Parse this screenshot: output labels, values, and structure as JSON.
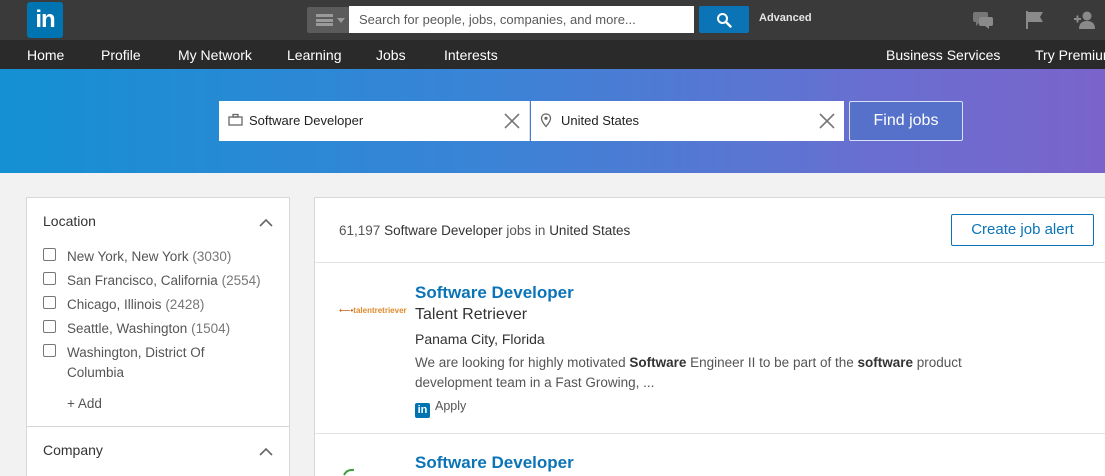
{
  "topbar": {
    "logo": "in",
    "search": {
      "placeholder": "Search for people, jobs, companies, and more..."
    },
    "advanced_label": "Advanced",
    "icons": [
      "messages-icon",
      "flag-icon",
      "add-connection-icon"
    ]
  },
  "nav": {
    "items": [
      "Home",
      "Profile",
      "My Network",
      "Learning",
      "Jobs",
      "Interests"
    ],
    "right_items": [
      "Business Services",
      "Try Premium"
    ]
  },
  "job_search": {
    "keyword": "Software Developer",
    "location": "United States",
    "button_label": "Find jobs"
  },
  "filters": {
    "location": {
      "title": "Location",
      "options": [
        {
          "label": "New York, New York",
          "count": "(3030)"
        },
        {
          "label": "San Francisco, California",
          "count": "(2554)"
        },
        {
          "label": "Chicago, Illinois",
          "count": "(2428)"
        },
        {
          "label": "Seattle, Washington",
          "count": "(1504)"
        },
        {
          "label": "Washington, District Of",
          "label2": "Columbia",
          "count": ""
        }
      ],
      "add_label": "+ Add"
    },
    "company": {
      "title": "Company"
    }
  },
  "results": {
    "count": "61,197",
    "keyword": "Software Developer",
    "middle": "jobs in",
    "location": "United States",
    "create_alert_label": "Create job alert",
    "jobs": [
      {
        "title": "Software Developer",
        "company": "Talent Retriever",
        "company_logo_text": "talentretriever",
        "location": "Panama City, Florida",
        "desc_1": "We are looking for highly motivated ",
        "desc_b1": "Software",
        "desc_2": " Engineer II to be part of the ",
        "desc_b2": "software",
        "desc_3": " product development team in a Fast Growing, ...",
        "apply_label": "Apply"
      },
      {
        "title": "Software Developer"
      }
    ]
  },
  "colors": {
    "accent": "#0b74b7",
    "topbar": "#3a3a3a",
    "navbar": "#2a2a2a",
    "find_button": "#5571c9"
  }
}
